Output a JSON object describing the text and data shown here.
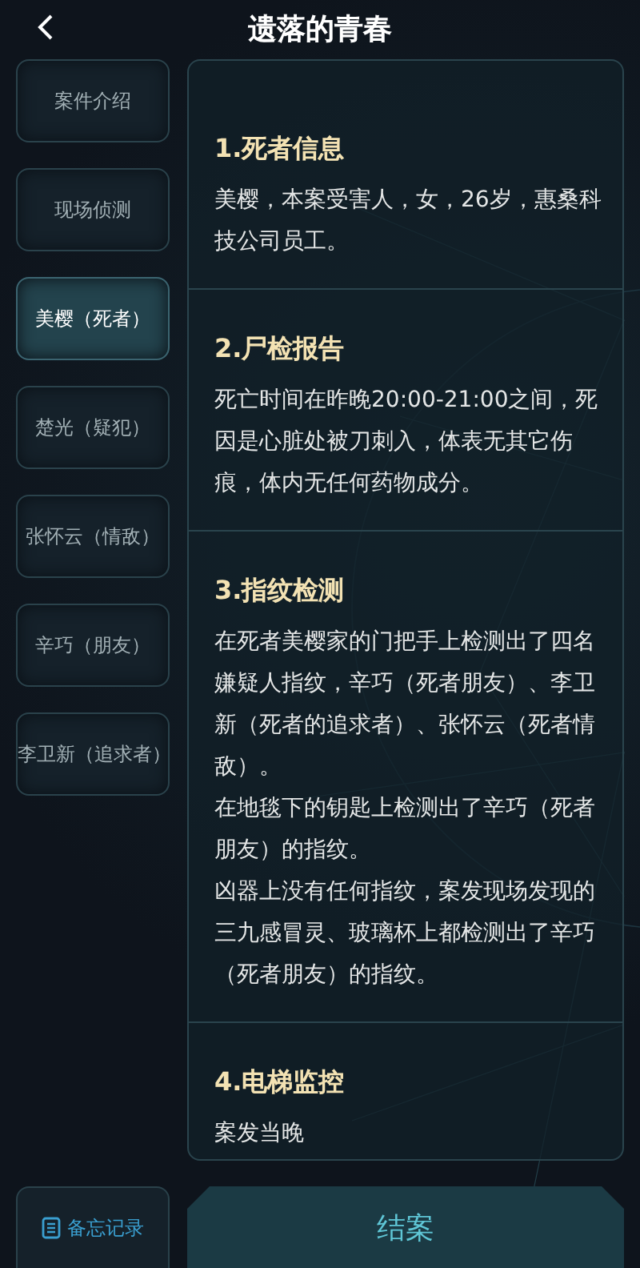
{
  "header": {
    "title": "遗落的青春"
  },
  "tabs": [
    {
      "label": "案件介绍",
      "selected": false
    },
    {
      "label": "现场侦测",
      "selected": false
    },
    {
      "label": "美樱（死者）",
      "selected": true
    },
    {
      "label": "楚光（疑犯）",
      "selected": false
    },
    {
      "label": "张怀云（情敌）",
      "selected": false
    },
    {
      "label": "辛巧（朋友）",
      "selected": false
    },
    {
      "label": "李卫新（追求者）",
      "selected": false
    }
  ],
  "sections": [
    {
      "title": "1.死者信息",
      "paragraphs": [
        "美樱，本案受害人，女，26岁，惠桑科技公司员工。"
      ]
    },
    {
      "title": "2.尸检报告",
      "paragraphs": [
        "死亡时间在昨晚20:00-21:00之间，死因是心脏处被刀刺入，体表无其它伤痕，体内无任何药物成分。"
      ]
    },
    {
      "title": "3.指纹检测",
      "paragraphs": [
        "在死者美樱家的门把手上检测出了四名嫌疑人指纹，辛巧（死者朋友）、李卫新（死者的追求者）、张怀云（死者情敌）。",
        "在地毯下的钥匙上检测出了辛巧（死者朋友）的指纹。",
        "凶器上没有任何指纹，案发现场发现的三九感冒灵、玻璃杯上都检测出了辛巧（死者朋友）的指纹。"
      ]
    },
    {
      "title": "4.电梯监控",
      "paragraphs": [
        "案发当晚"
      ]
    }
  ],
  "memo_button": {
    "label": "备忘记录"
  },
  "close_case_button": {
    "label": "结案"
  }
}
